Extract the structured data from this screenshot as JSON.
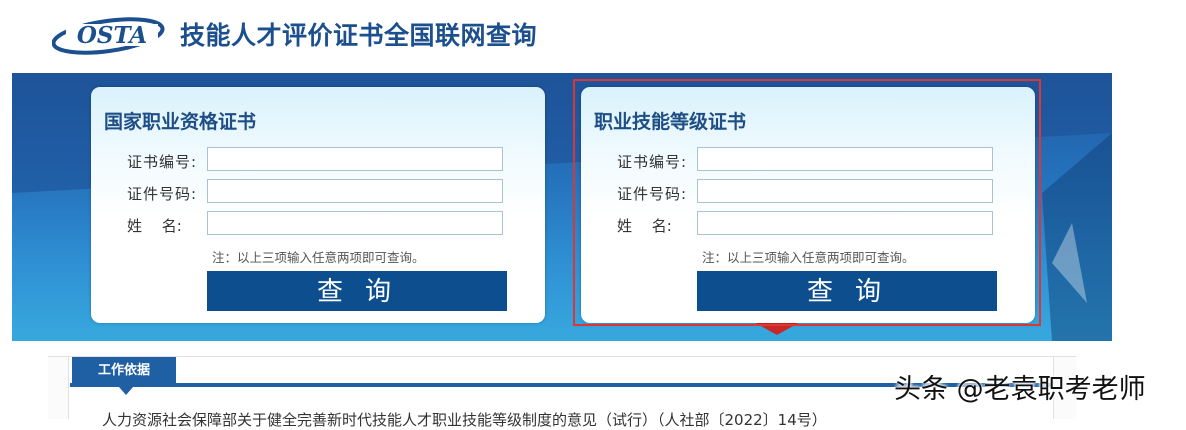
{
  "header": {
    "logo_text": "OSTA",
    "title": "技能人才评价证书全国联网查询"
  },
  "forms": {
    "national": {
      "title": "国家职业资格证书",
      "cert_no_label": "证书编号:",
      "id_no_label": "证件号码:",
      "name_label": "姓　 名:",
      "cert_no_value": "",
      "id_no_value": "",
      "name_value": "",
      "note": "注：以上三项输入任意两项即可查询。",
      "button_label": "查询"
    },
    "skill": {
      "title": "职业技能等级证书",
      "cert_no_label": "证书编号:",
      "id_no_label": "证件号码:",
      "name_label": "姓　 名:",
      "cert_no_value": "",
      "id_no_value": "",
      "name_value": "",
      "note": "注：以上三项输入任意两项即可查询。",
      "button_label": "查询"
    }
  },
  "lower": {
    "tab_label": "工作依据",
    "doc_text": "人力资源社会保障部关于健全完善新时代技能人才职业技能等级制度的意见（试行）（人社部〔2022〕14号）"
  },
  "watermark": "头条 @老袁职考老师",
  "colors": {
    "brand_blue": "#1c4f8e",
    "button_blue": "#0d4f8e",
    "highlight_red": "#e03535"
  }
}
